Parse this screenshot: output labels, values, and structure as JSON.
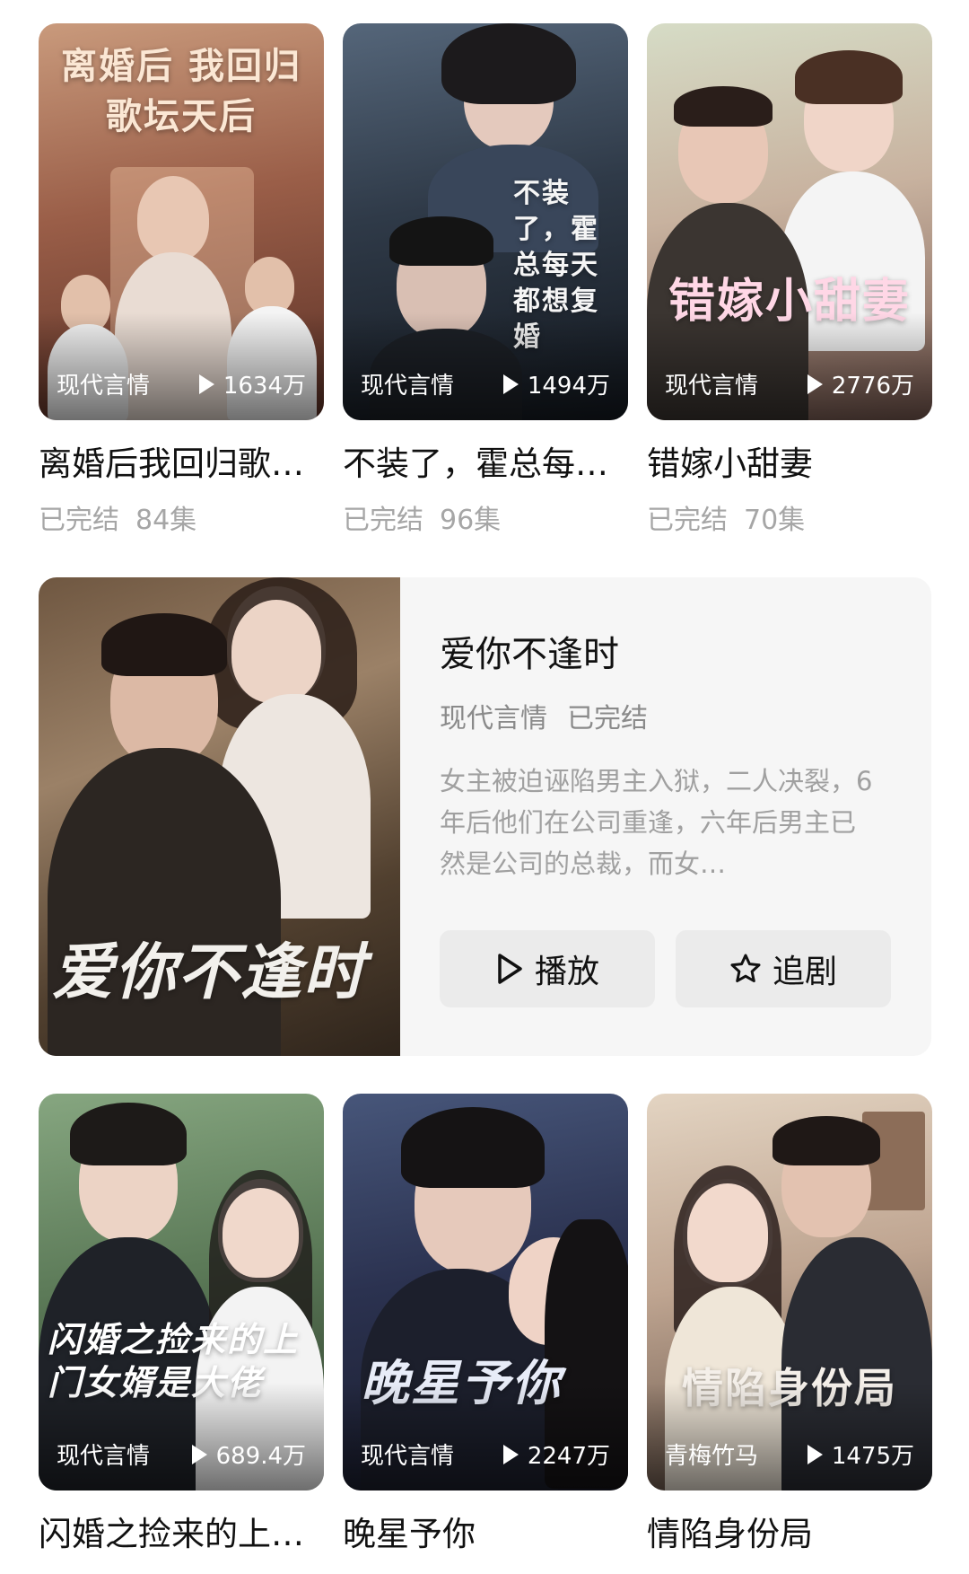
{
  "row1": [
    {
      "title": "离婚后我回归歌…",
      "genre": "现代言情",
      "views": "1634万",
      "status": "已完结",
      "episodes": "84集",
      "poster_art": "离婚后 我回归歌坛天后",
      "colors": {
        "top": "#b9876a",
        "mid": "#8c5540",
        "bottom": "#4a2a22"
      }
    },
    {
      "title": "不装了，霍总每…",
      "genre": "现代言情",
      "views": "1494万",
      "status": "已完结",
      "episodes": "96集",
      "poster_art": "不装了，霍总每天都想复婚",
      "colors": {
        "top": "#4b5866",
        "mid": "#2c3440",
        "bottom": "#151a21"
      }
    },
    {
      "title": "错嫁小甜妻",
      "genre": "现代言情",
      "views": "2776万",
      "status": "已完结",
      "episodes": "70集",
      "poster_art": "错嫁小甜妻",
      "colors": {
        "top": "#cdd6c0",
        "mid": "#c9a89a",
        "bottom": "#6b4d46"
      }
    }
  ],
  "featured": {
    "title": "爱你不逢时",
    "genre": "现代言情",
    "status": "已完结",
    "description": "女主被迫诬陷男主入狱，二人决裂，6年后他们在公司重逢，六年后男主已然是公司的总裁，而女…",
    "poster_art": "爱你不逢时",
    "play_label": "播放",
    "follow_label": "追剧"
  },
  "row2": [
    {
      "title": "闪婚之捡来的上…",
      "genre": "现代言情",
      "views": "689.4万",
      "poster_art": "闪婚之捡来的上门女婿是大佬",
      "colors": {
        "top": "#7fa07a",
        "mid": "#587554",
        "bottom": "#2e3a2c"
      }
    },
    {
      "title": "晚星予你",
      "genre": "现代言情",
      "views": "2247万",
      "poster_art": "晚星予你",
      "colors": {
        "top": "#3c4a64",
        "mid": "#2a3046",
        "bottom": "#1a1c2a"
      }
    },
    {
      "title": "情陷身份局",
      "genre": "青梅竹马",
      "views": "1475万",
      "poster_art": "情陷身份局",
      "colors": {
        "top": "#d9c8b6",
        "mid": "#b8a08c",
        "bottom": "#5a4a40"
      }
    }
  ]
}
